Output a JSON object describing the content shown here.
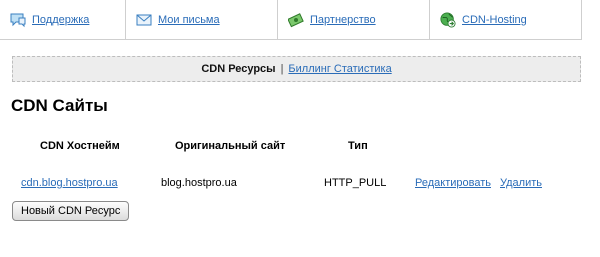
{
  "topnav": {
    "items": [
      {
        "label": "Поддержка",
        "icon": "support-icon"
      },
      {
        "label": "Мои письма",
        "icon": "mail-icon"
      },
      {
        "label": "Партнерство",
        "icon": "money-icon"
      },
      {
        "label": "CDN-Hosting",
        "icon": "globe-icon"
      }
    ]
  },
  "subnav": {
    "current": "CDN Ресурсы",
    "separator": "|",
    "link": "Биллинг Статистика"
  },
  "page_title": "CDN Сайты",
  "table": {
    "headers": [
      "CDN Хостнейм",
      "Оригинальный сайт",
      "Тип"
    ],
    "rows": [
      {
        "hostname": "cdn.blog.hostpro.ua",
        "origin": "blog.hostpro.ua",
        "type": "HTTP_PULL",
        "edit_label": "Редактировать",
        "delete_label": "Удалить"
      }
    ]
  },
  "new_button_label": "Новый CDN Ресурс",
  "colors": {
    "link": "#2a6cb8",
    "subnav_bg": "#ededed"
  }
}
